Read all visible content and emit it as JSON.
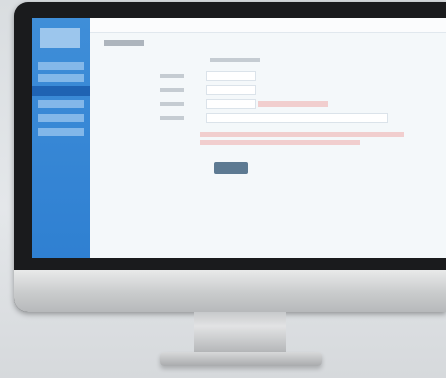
{
  "window": {
    "title": ""
  },
  "sidebar": {
    "items": [
      {
        "label": ""
      },
      {
        "label": ""
      },
      {
        "label": ""
      },
      {
        "label": ""
      },
      {
        "label": ""
      },
      {
        "label": ""
      }
    ]
  },
  "main": {
    "page_title": "",
    "form": {
      "fields": [
        {
          "label": "",
          "value": ""
        },
        {
          "label": "",
          "value": ""
        },
        {
          "label": "",
          "value": ""
        },
        {
          "label": "",
          "value": ""
        }
      ],
      "save_label": ""
    }
  },
  "colors": {
    "sidebar": "#2f80d2",
    "sidebar_active": "#1f63b3",
    "content_bg": "#f4f8fa",
    "error_text": "#e06666",
    "button": "#5d7a92",
    "bezel": "#1a1b1d"
  }
}
